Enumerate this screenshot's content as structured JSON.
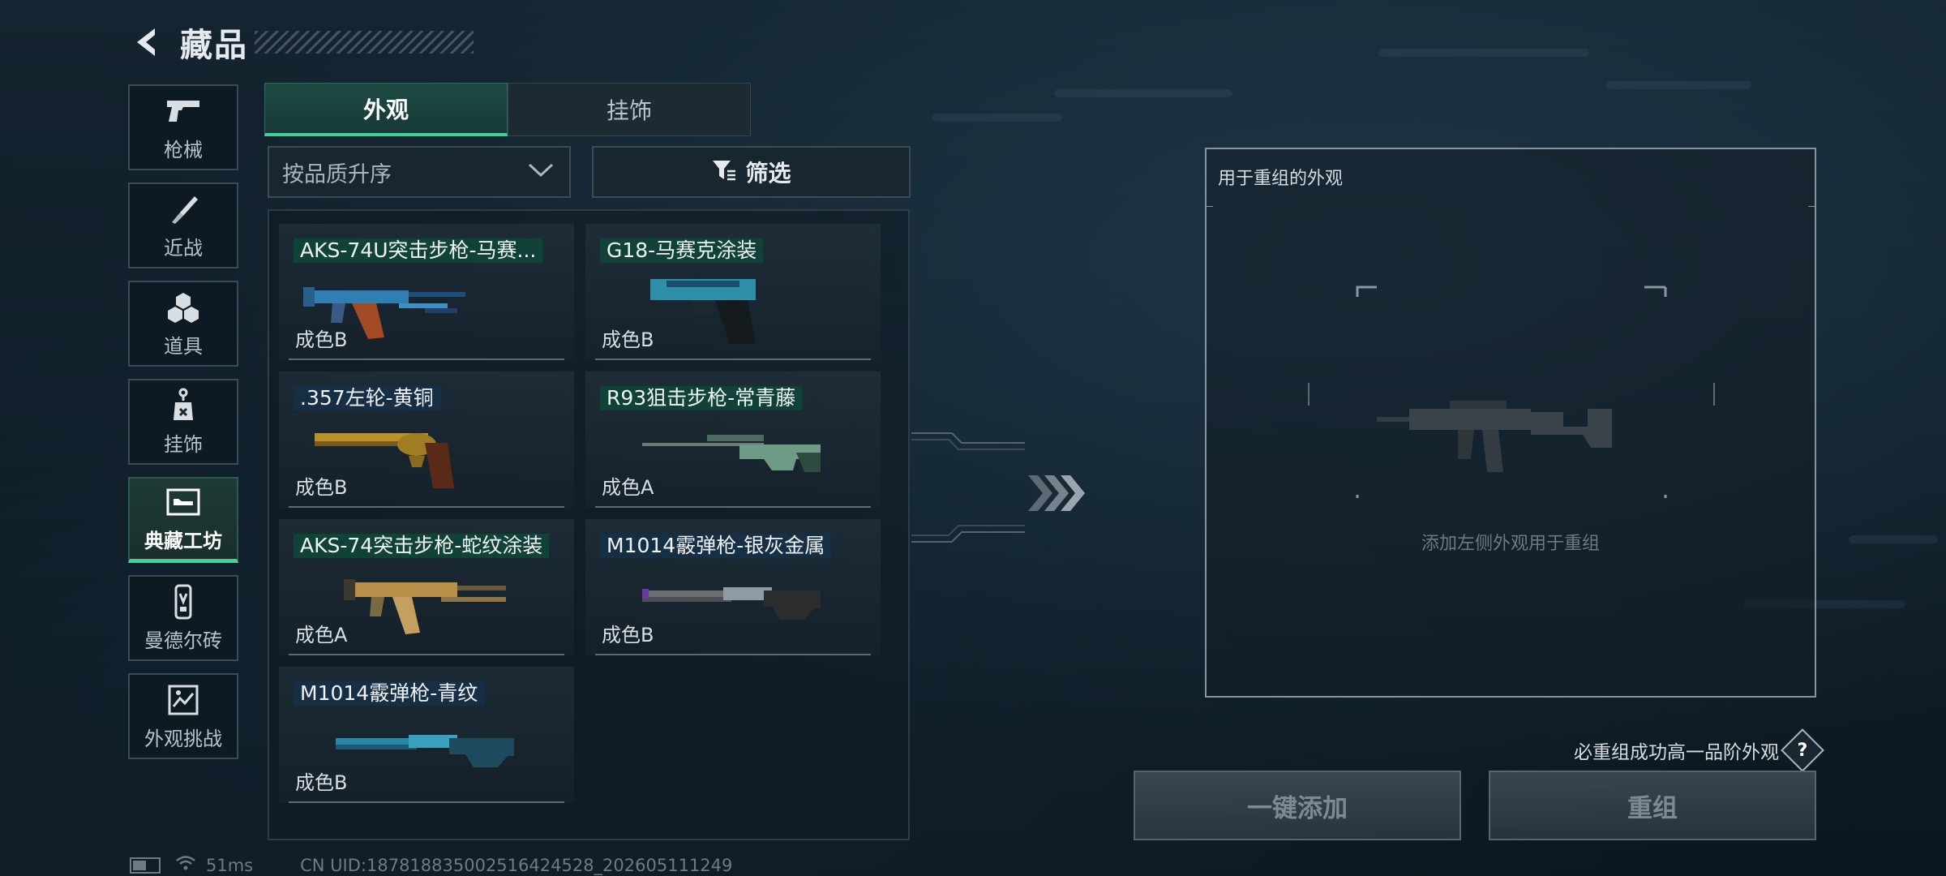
{
  "header": {
    "title": "藏品",
    "back_icon": "back-arrow-icon"
  },
  "nav": [
    {
      "label": "枪械",
      "icon": "pistol-icon",
      "active": false
    },
    {
      "label": "近战",
      "icon": "knife-icon",
      "active": false
    },
    {
      "label": "道具",
      "icon": "grenade-icon",
      "active": false
    },
    {
      "label": "挂饰",
      "icon": "charm-icon",
      "active": false
    },
    {
      "label": "典藏工坊",
      "icon": "workshop-icon",
      "active": true
    },
    {
      "label": "曼德尔砖",
      "icon": "brick-icon",
      "active": false
    },
    {
      "label": "外观挑战",
      "icon": "challenge-icon",
      "active": false
    }
  ],
  "tabs": [
    {
      "label": "外观",
      "active": true
    },
    {
      "label": "挂饰",
      "active": false
    }
  ],
  "sort": {
    "label": "按品质升序"
  },
  "filter": {
    "label": "筛选"
  },
  "items": [
    {
      "name": "AKS-74U突击步枪-马赛...",
      "grade": "成色B",
      "weapon": "rifle",
      "accent": "#2f7fb5"
    },
    {
      "name": "G18-马赛克涂装",
      "grade": "成色B",
      "weapon": "pistol",
      "accent": "#2e8fa8"
    },
    {
      "name": ".357左轮-黄铜",
      "grade": "成色B",
      "weapon": "revolver",
      "accent": "#b8902c"
    },
    {
      "name": "R93狙击步枪-常青藤",
      "grade": "成色A",
      "weapon": "sniper",
      "accent": "#6e9b86"
    },
    {
      "name": "AKS-74突击步枪-蛇纹涂装",
      "grade": "成色A",
      "weapon": "rifle",
      "accent": "#b98f4a"
    },
    {
      "name": "M1014霰弹枪-银灰金属",
      "grade": "成色B",
      "weapon": "shotgun",
      "accent": "#8f9aa3"
    },
    {
      "name": "M1014霰弹枪-青纹",
      "grade": "成色B",
      "weapon": "shotgun",
      "accent": "#2a86a6"
    }
  ],
  "reorg_panel": {
    "title": "用于重组的外观",
    "hint": "添加左侧外观用于重组"
  },
  "note": "必重组成功高一品阶外观",
  "help_label": "?",
  "buttons": {
    "add": "一键添加",
    "reorganize": "重组"
  },
  "status": {
    "ping": "51ms",
    "uid": "CN UID:187818835002516424528_202605111249"
  },
  "colors": {
    "accent_green": "#3fd39a",
    "tag_green": "#0e463a"
  }
}
